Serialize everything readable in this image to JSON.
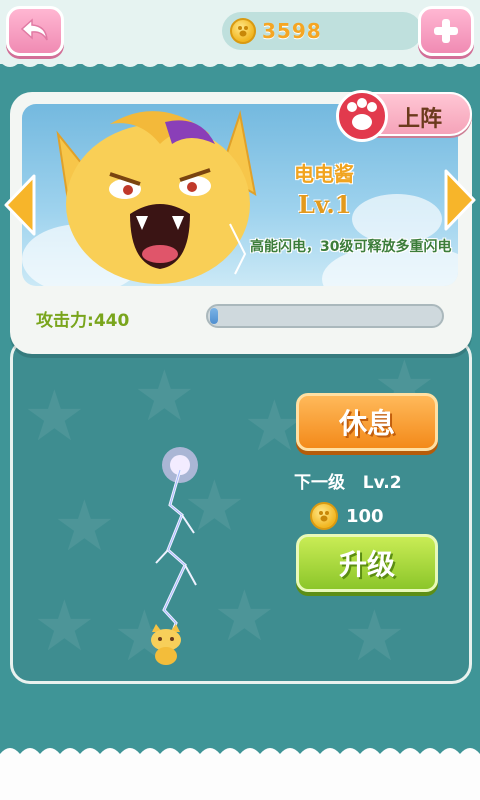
{
  "header": {
    "coins": "3598",
    "back_icon": "back-arrow-icon",
    "add_icon": "plus-icon"
  },
  "pet": {
    "name": "电电酱",
    "level": "Lv.1",
    "description": "高能闪电，30级可释放多重闪电",
    "deploy_label": "上阵",
    "attack_label": "攻击力:",
    "attack_value": "440",
    "attack_progress": 0.03
  },
  "actions": {
    "rest_label": "休息",
    "next_level_label": "下一级",
    "next_level_value": "Lv.2",
    "upgrade_cost": "100",
    "upgrade_label": "升级"
  },
  "colors": {
    "background": "#3f9597",
    "coin": "#f2b620",
    "rest_button": "#f38a1a",
    "upgrade_button": "#8cc62a",
    "pink_button": "#f08bb3"
  }
}
